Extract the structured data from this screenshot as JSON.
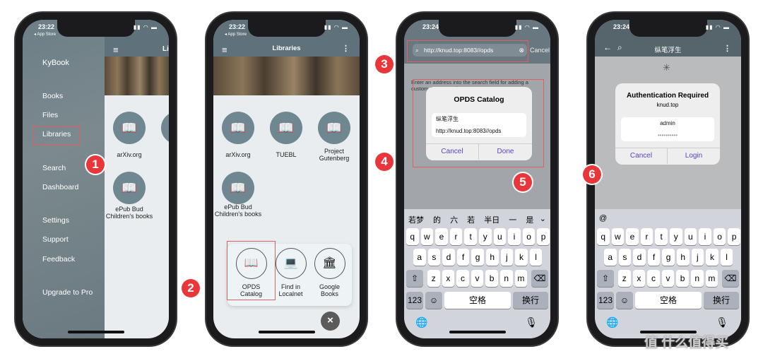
{
  "phone1": {
    "time": "23:22",
    "back": "◂ App Store",
    "header_partial": "Li",
    "drawer": {
      "app": "KyBook",
      "items": [
        "Books",
        "Files",
        "Libraries",
        "Search",
        "Dashboard",
        "Settings",
        "Support",
        "Feedback",
        "Upgrade to Pro"
      ]
    },
    "libraries": [
      "arXiv.org",
      "ePub Bud Children's books"
    ]
  },
  "phone2": {
    "time": "23:22",
    "back": "◂ App Store",
    "title": "Libraries",
    "libraries": [
      "arXiv.org",
      "TUEBL",
      "Project Gutenberg",
      "ePub Bud Children's books"
    ],
    "add_menu": [
      {
        "label": "OPDS Catalog",
        "icon": "book-reader-icon"
      },
      {
        "label": "Find in Localnet",
        "icon": "laptop-icon"
      },
      {
        "label": "Google Books",
        "icon": "bank-icon"
      }
    ],
    "close": "×"
  },
  "phone3": {
    "time": "23:24",
    "search_value": "http://knud.top:8083//opds",
    "cancel": "Cancel",
    "hint": "Enter an address into the search field for adding a custom OPDS catalog",
    "dialog": {
      "title": "OPDS Catalog",
      "name": "纵笔浮生",
      "url": "http://knud.top:8083//opds",
      "cancel": "Cancel",
      "done": "Done"
    },
    "candidates": [
      "若梦",
      "的",
      "六",
      "若",
      "半日",
      "一",
      "是"
    ]
  },
  "phone4": {
    "time": "23:24",
    "title": "纵笔浮生",
    "dialog": {
      "title": "Authentication Required",
      "host": "knud.top",
      "user": "admin",
      "password": "••••••••••",
      "cancel": "Cancel",
      "login": "Login"
    },
    "candidates": [
      "@"
    ]
  },
  "keyboard": {
    "row1": [
      "q",
      "w",
      "e",
      "r",
      "t",
      "y",
      "u",
      "i",
      "o",
      "p"
    ],
    "row2": [
      "a",
      "s",
      "d",
      "f",
      "g",
      "h",
      "j",
      "k",
      "l"
    ],
    "row3": [
      "z",
      "x",
      "c",
      "v",
      "b",
      "n",
      "m"
    ],
    "num": "123",
    "space": "空格",
    "return": "换行"
  },
  "markers": [
    "1",
    "2",
    "3",
    "4",
    "5",
    "6"
  ],
  "watermark": "值 什么值得买",
  "colors": {
    "header": "#5f727b",
    "accent": "#5a3fd0",
    "marker": "#e8363a"
  }
}
